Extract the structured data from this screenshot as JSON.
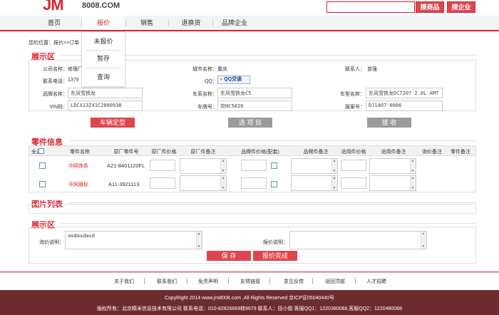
{
  "header": {
    "logo_text": "8008.COM",
    "search_placeholder": "",
    "search_goods_label": "搜商品",
    "search_company_label": "搜企业"
  },
  "nav": {
    "items": [
      "首页",
      "报价",
      "销售",
      "退换货",
      "品牌企业"
    ],
    "active": "报价"
  },
  "dropdown": {
    "items": [
      "未报价",
      "暂存",
      "查询"
    ]
  },
  "breadcrumb": "您的位置：报价>>订单",
  "display_section": {
    "title": "展示区",
    "company_label": "公司名称：",
    "company_value": "修理厂",
    "city_label": "城市名称：",
    "city_value": "重庆",
    "contact_label": "联系人：",
    "contact_value": "曾强",
    "phone_label": "联系电话：",
    "phone_value": "1379",
    "qq_label": "QQ：",
    "qq_button": "QQ交谈",
    "brand_label": "品牌名称：",
    "brand_value": "东风雪铁龙",
    "series_label": "车系名称：",
    "series_value": "东风雪铁龙C5",
    "model_label": "车型名称：",
    "model_value": "东风雪铁龙DC7207 2.0L AMT",
    "vin_label": "VIN码：",
    "vin_value": "LDCA13Z41C2000938",
    "plate_label": "车牌号：",
    "plate_value": "京NC5820",
    "quote_label": "报案号：",
    "quote_value": "DJ1407-0006",
    "btn_vehicle": "车辆定型",
    "btn_select": "选 项 目",
    "btn_receive": "接 收"
  },
  "parts_section": {
    "title": "零件信息",
    "headers": [
      "全选",
      "零件名称",
      "原厂零件号",
      "原厂件价格",
      "原厂件备注",
      "品牌件价格(配套)",
      "品牌件备注",
      "适用件价格",
      "适用件备注",
      "询价备注",
      "零件备注"
    ],
    "rows": [
      {
        "name": "中网饰条",
        "code": "A21-8401120FL"
      },
      {
        "name": "中网旗标",
        "code": "A11-3921113"
      }
    ]
  },
  "images_section": {
    "title": "图片列表"
  },
  "display_section2": {
    "title": "展示区",
    "inquiry_label": "询价说明：",
    "inquiry_value": "asdasdasd",
    "quote_note_label": "报价说明：",
    "btn_save": "保 存",
    "btn_done": "报价完成"
  },
  "footer": {
    "links": [
      "关于我们",
      "联系我们",
      "免责声明",
      "友情链接",
      "意见反馈",
      "返回顶部",
      "人才招聘"
    ],
    "copyright": "CopyRight 2014 www.jm8008.com ,All Rights Reserved 京ICP证05040440号",
    "info": "版权所有：北京精米信息技术有限公司 联系电话：010-82826669转8679 联系人：田小姐 客服QQ1：1220380088,客服QQ2：1220480088"
  }
}
